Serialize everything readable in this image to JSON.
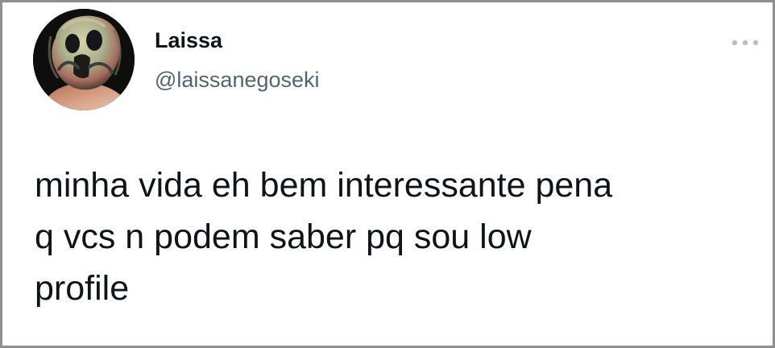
{
  "tweet": {
    "author": {
      "display_name": "Laissa",
      "handle": "@laissanegoseki",
      "avatar_icon": "profile-photo"
    },
    "more_icon": "more-horizontal-icon",
    "text_lines": [
      "minha vida eh bem interessante pena",
      "q vcs n podem saber pq sou low",
      "profile"
    ]
  },
  "colors": {
    "border": "#8f8f8f",
    "background": "#ffffff",
    "primary_text": "#0f1419",
    "secondary_text": "#536471",
    "more_icon": "#b7c0c8"
  }
}
